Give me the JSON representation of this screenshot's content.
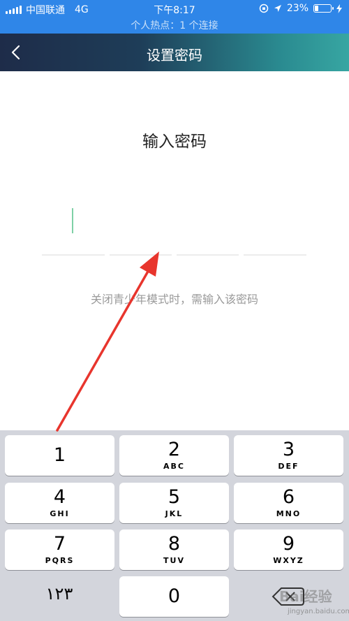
{
  "status_bar": {
    "carrier": "中国联通",
    "network": "4G",
    "time": "下午8:17",
    "battery_percent": "23%",
    "battery_level": 0.23,
    "hotspot": "个人热点：1 个连接"
  },
  "nav": {
    "title": "设置密码"
  },
  "pin_entry": {
    "heading": "输入密码",
    "hint": "关闭青少年模式时，需输入该密码",
    "digit_count": 4
  },
  "keyboard": {
    "keys": [
      {
        "digit": "1",
        "letters": ""
      },
      {
        "digit": "2",
        "letters": "ABC"
      },
      {
        "digit": "3",
        "letters": "DEF"
      },
      {
        "digit": "4",
        "letters": "GHI"
      },
      {
        "digit": "5",
        "letters": "JKL"
      },
      {
        "digit": "6",
        "letters": "MNO"
      },
      {
        "digit": "7",
        "letters": "PQRS"
      },
      {
        "digit": "8",
        "letters": "TUV"
      },
      {
        "digit": "9",
        "letters": "WXYZ"
      }
    ],
    "zero_digit": "0",
    "alt_key": "١٢٣"
  },
  "watermark": {
    "brand": "Bai经验",
    "url": "jingyan.baidu.com"
  },
  "colors": {
    "status_bar_bg": "#2f86e8",
    "cursor": "#7fd0a6",
    "arrow": "#e8352d",
    "keyboard_bg": "#d3d5dc"
  }
}
